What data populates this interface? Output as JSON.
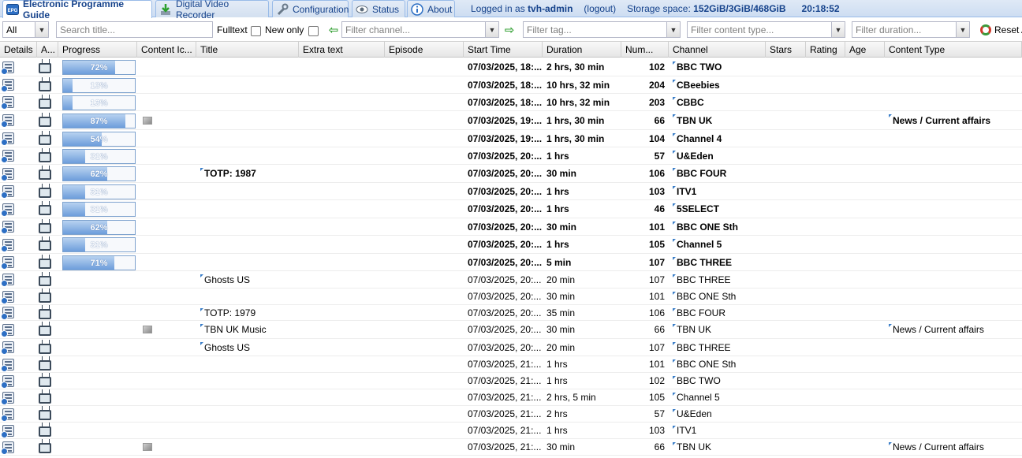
{
  "tabs": [
    {
      "label": "Electronic Programme Guide",
      "icon": "epg-icon",
      "active": true
    },
    {
      "label": "Digital Video Recorder",
      "icon": "download-icon"
    },
    {
      "label": "Configuration",
      "icon": "wrench-icon"
    },
    {
      "label": "Status",
      "icon": "eye-icon"
    },
    {
      "label": "About",
      "icon": "info-icon"
    }
  ],
  "session": {
    "logged_in_prefix": "Logged in as ",
    "user": "tvh-admin",
    "logout": "(logout)",
    "storage_prefix": "Storage space: ",
    "storage": "152GiB/3GiB/468GiB",
    "clock": "20:18:52"
  },
  "filters": {
    "scope_value": "All",
    "title_placeholder": "Search title...",
    "fulltext_label": "Fulltext",
    "new_only_label": "New only",
    "channel_placeholder": "Filter channel...",
    "tag_placeholder": "Filter tag...",
    "content_type_placeholder": "Filter content type...",
    "duration_placeholder": "Filter duration...",
    "reset_label": "Reset A"
  },
  "columns": [
    "Details",
    "A...",
    "Progress",
    "Content Ic...",
    "Title",
    "Extra text",
    "Episode",
    "Start Time",
    "Duration",
    "Num...",
    "Channel",
    "Stars",
    "Rating",
    "Age",
    "Content Type"
  ],
  "rows": [
    {
      "progress": 72,
      "progress_label": "72%",
      "image": false,
      "title": "",
      "start": "07/03/2025, 18:...",
      "duration": "2 hrs, 30 min",
      "num": "102",
      "channel": "BBC TWO",
      "content_type": "",
      "bold": true
    },
    {
      "progress": 13,
      "progress_label": "13%",
      "image": false,
      "title": "",
      "start": "07/03/2025, 18:...",
      "duration": "10 hrs, 32 min",
      "num": "204",
      "channel": "CBeebies",
      "content_type": "",
      "bold": true
    },
    {
      "progress": 13,
      "progress_label": "13%",
      "image": false,
      "title": "",
      "start": "07/03/2025, 18:...",
      "duration": "10 hrs, 32 min",
      "num": "203",
      "channel": "CBBC",
      "content_type": "",
      "bold": true
    },
    {
      "progress": 87,
      "progress_label": "87%",
      "image": true,
      "title": "",
      "start": "07/03/2025, 19:...",
      "duration": "1 hrs, 30 min",
      "num": "66",
      "channel": "TBN UK",
      "content_type": "News / Current affairs",
      "bold": true
    },
    {
      "progress": 54,
      "progress_label": "54%",
      "image": false,
      "title": "",
      "start": "07/03/2025, 19:...",
      "duration": "1 hrs, 30 min",
      "num": "104",
      "channel": "Channel 4",
      "content_type": "",
      "bold": true
    },
    {
      "progress": 31,
      "progress_label": "31%",
      "image": false,
      "title": "",
      "start": "07/03/2025, 20:...",
      "duration": "1 hrs",
      "num": "57",
      "channel": "U&Eden",
      "content_type": "",
      "bold": true
    },
    {
      "progress": 62,
      "progress_label": "62%",
      "image": false,
      "title": "TOTP: 1987",
      "start": "07/03/2025, 20:...",
      "duration": "30 min",
      "num": "106",
      "channel": "BBC FOUR",
      "content_type": "",
      "bold": true
    },
    {
      "progress": 31,
      "progress_label": "31%",
      "image": false,
      "title": "",
      "start": "07/03/2025, 20:...",
      "duration": "1 hrs",
      "num": "103",
      "channel": "ITV1",
      "content_type": "",
      "bold": true
    },
    {
      "progress": 31,
      "progress_label": "31%",
      "image": false,
      "title": "",
      "start": "07/03/2025, 20:...",
      "duration": "1 hrs",
      "num": "46",
      "channel": "5SELECT",
      "content_type": "",
      "bold": true
    },
    {
      "progress": 62,
      "progress_label": "62%",
      "image": false,
      "title": "",
      "start": "07/03/2025, 20:...",
      "duration": "30 min",
      "num": "101",
      "channel": "BBC ONE Sth",
      "content_type": "",
      "bold": true
    },
    {
      "progress": 31,
      "progress_label": "31%",
      "image": false,
      "title": "",
      "start": "07/03/2025, 20:...",
      "duration": "1 hrs",
      "num": "105",
      "channel": "Channel 5",
      "content_type": "",
      "bold": true
    },
    {
      "progress": 71,
      "progress_label": "71%",
      "image": false,
      "title": "",
      "start": "07/03/2025, 20:...",
      "duration": "5 min",
      "num": "107",
      "channel": "BBC THREE",
      "content_type": "",
      "bold": true
    },
    {
      "progress": null,
      "progress_label": "",
      "image": false,
      "title": "Ghosts US",
      "start": "07/03/2025, 20:...",
      "duration": "20 min",
      "num": "107",
      "channel": "BBC THREE",
      "content_type": "",
      "bold": false
    },
    {
      "progress": null,
      "progress_label": "",
      "image": false,
      "title": "",
      "start": "07/03/2025, 20:...",
      "duration": "30 min",
      "num": "101",
      "channel": "BBC ONE Sth",
      "content_type": "",
      "bold": false
    },
    {
      "progress": null,
      "progress_label": "",
      "image": false,
      "title": "TOTP: 1979",
      "start": "07/03/2025, 20:...",
      "duration": "35 min",
      "num": "106",
      "channel": "BBC FOUR",
      "content_type": "",
      "bold": false
    },
    {
      "progress": null,
      "progress_label": "",
      "image": true,
      "title": "TBN UK Music",
      "start": "07/03/2025, 20:...",
      "duration": "30 min",
      "num": "66",
      "channel": "TBN UK",
      "content_type": "News / Current affairs",
      "bold": false
    },
    {
      "progress": null,
      "progress_label": "",
      "image": false,
      "title": "Ghosts US",
      "start": "07/03/2025, 20:...",
      "duration": "20 min",
      "num": "107",
      "channel": "BBC THREE",
      "content_type": "",
      "bold": false
    },
    {
      "progress": null,
      "progress_label": "",
      "image": false,
      "title": "",
      "start": "07/03/2025, 21:...",
      "duration": "1 hrs",
      "num": "101",
      "channel": "BBC ONE Sth",
      "content_type": "",
      "bold": false
    },
    {
      "progress": null,
      "progress_label": "",
      "image": false,
      "title": "",
      "start": "07/03/2025, 21:...",
      "duration": "1 hrs",
      "num": "102",
      "channel": "BBC TWO",
      "content_type": "",
      "bold": false
    },
    {
      "progress": null,
      "progress_label": "",
      "image": false,
      "title": "",
      "start": "07/03/2025, 21:...",
      "duration": "2 hrs, 5 min",
      "num": "105",
      "channel": "Channel 5",
      "content_type": "",
      "bold": false
    },
    {
      "progress": null,
      "progress_label": "",
      "image": false,
      "title": "",
      "start": "07/03/2025, 21:...",
      "duration": "2 hrs",
      "num": "57",
      "channel": "U&Eden",
      "content_type": "",
      "bold": false
    },
    {
      "progress": null,
      "progress_label": "",
      "image": false,
      "title": "",
      "start": "07/03/2025, 21:...",
      "duration": "1 hrs",
      "num": "103",
      "channel": "ITV1",
      "content_type": "",
      "bold": false
    },
    {
      "progress": null,
      "progress_label": "",
      "image": true,
      "title": "",
      "start": "07/03/2025, 21:...",
      "duration": "30 min",
      "num": "66",
      "channel": "TBN UK",
      "content_type": "News / Current affairs",
      "bold": false
    }
  ]
}
